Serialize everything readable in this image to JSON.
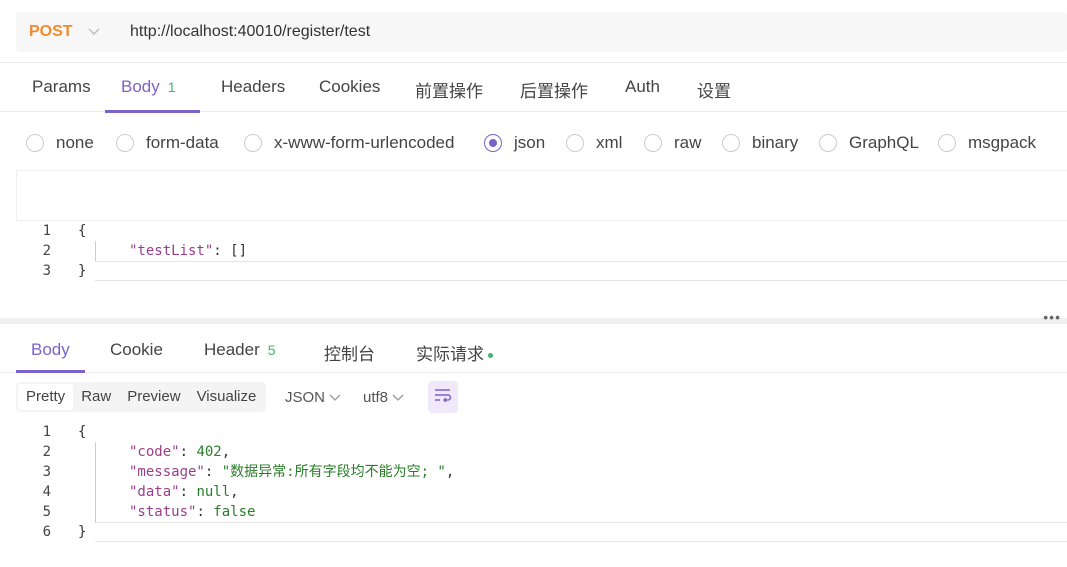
{
  "request": {
    "method": "POST",
    "url": "http://localhost:40010/register/test"
  },
  "req_tabs": [
    {
      "label": "Params"
    },
    {
      "label": "Body",
      "count": "1"
    },
    {
      "label": "Headers"
    },
    {
      "label": "Cookies"
    },
    {
      "label": "前置操作"
    },
    {
      "label": "后置操作"
    },
    {
      "label": "Auth"
    },
    {
      "label": "设置"
    }
  ],
  "body_types": {
    "options": [
      "none",
      "form-data",
      "x-www-form-urlencoded",
      "json",
      "xml",
      "raw",
      "binary",
      "GraphQL",
      "msgpack"
    ],
    "selected": "json"
  },
  "request_body": {
    "line_numbers": [
      "1",
      "2",
      "3"
    ],
    "open": "{",
    "key": "\"testList\"",
    "colon": ": ",
    "value": "[]",
    "close": "}"
  },
  "resp_tabs": [
    {
      "label": "Body"
    },
    {
      "label": "Cookie"
    },
    {
      "label": "Header",
      "count": "5"
    },
    {
      "label": "控制台"
    },
    {
      "label": "实际请求"
    }
  ],
  "resp_toolbar": {
    "views": [
      "Pretty",
      "Raw",
      "Preview",
      "Visualize"
    ],
    "active_view": "Pretty",
    "format": "JSON",
    "encoding": "utf8"
  },
  "response_body": {
    "line_numbers": [
      "1",
      "2",
      "3",
      "4",
      "5",
      "6"
    ],
    "open": "{",
    "code_key": "\"code\"",
    "code_value": "402",
    "message_key": "\"message\"",
    "message_value": "\"数据异常:所有字段均不能为空; \"",
    "data_key": "\"data\"",
    "data_value": "null",
    "status_key": "\"status\"",
    "status_value": "false",
    "close": "}"
  },
  "colors": {
    "accent": "#7b63c9",
    "method": "#f08c2e",
    "count": "#3eb86a"
  },
  "icons": [
    "chevron-down-icon",
    "more-icon",
    "wrap-lines-icon"
  ]
}
